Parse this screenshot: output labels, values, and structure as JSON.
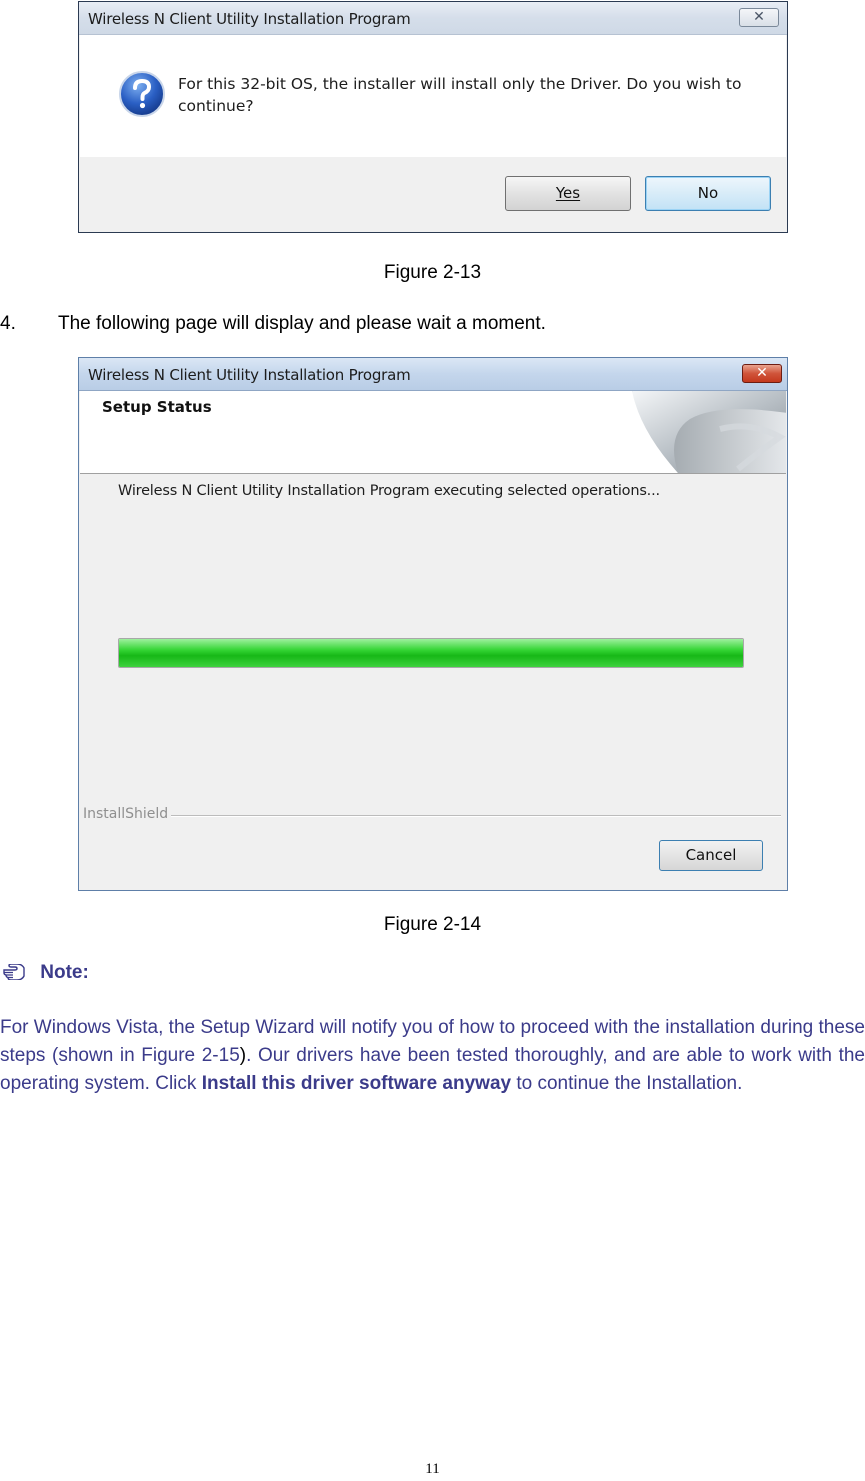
{
  "dialog1": {
    "title": "Wireless N Client Utility Installation Program",
    "close_glyph": "✕",
    "message_line1": "For this 32-bit OS, the installer will install only the Driver. Do you wish to",
    "message_line2": "continue?",
    "icon": "question-icon",
    "yes_label": "Yes",
    "no_label": "No"
  },
  "figure1_caption": "Figure 2-13",
  "step": {
    "number": "4.",
    "text": "The following page will display and please wait a moment."
  },
  "dialog2": {
    "title": "Wireless N Client Utility Installation Program",
    "close_glyph": "✕",
    "header_title": "Setup Status",
    "status_text": "Wireless N Client Utility Installation Program executing selected operations...",
    "progress_fraction": 1.0,
    "footer_brand": "InstallShield",
    "cancel_label": "Cancel",
    "colors": {
      "progress": "#22c622",
      "close_button": "#c4391e"
    }
  },
  "figure2_caption": "Figure 2-14",
  "note": {
    "icon": "pointing-hand-icon",
    "label": "Note:",
    "text_part1": "For Windows Vista, the Setup Wizard will notify you of how to proceed with the installation during these steps (shown in Figure 2-15",
    "text_part2": ")",
    "text_part3": ". Our drivers have been tested thoroughly, and are able to work with the operating system. Click ",
    "emphasis": "Install this driver software anyway",
    "text_part4": " to continue the Installation.",
    "color": "#3b3b8a"
  },
  "page_number": "11"
}
